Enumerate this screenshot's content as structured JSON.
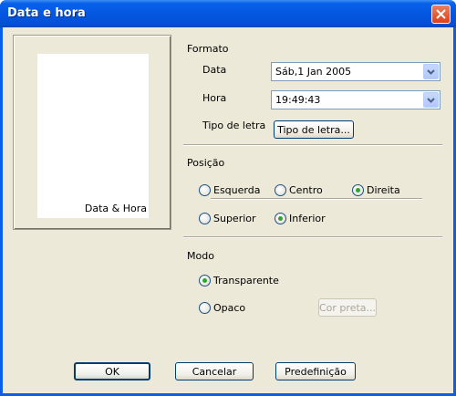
{
  "window": {
    "title": "Data e hora"
  },
  "preview": {
    "label": "Data & Hora"
  },
  "formato": {
    "heading": "Formato",
    "data_label": "Data",
    "data_value": "Sáb,1 Jan 2005",
    "hora_label": "Hora",
    "hora_value": "19:49:43",
    "tipo_label": "Tipo de letra",
    "tipo_button": "Tipo de letra..."
  },
  "posicao": {
    "heading": "Posição",
    "horizontal": [
      {
        "label": "Esquerda",
        "selected": false
      },
      {
        "label": "Centro",
        "selected": false
      },
      {
        "label": "Direita",
        "selected": true
      }
    ],
    "vertical": [
      {
        "label": "Superior",
        "selected": false
      },
      {
        "label": "Inferior",
        "selected": true
      }
    ]
  },
  "modo": {
    "heading": "Modo",
    "options": [
      {
        "label": "Transparente",
        "selected": true
      },
      {
        "label": "Opaco",
        "selected": false
      }
    ],
    "color_button": "Cor preta..."
  },
  "footer": {
    "ok": "OK",
    "cancel": "Cancelar",
    "default": "Predefinição"
  },
  "icons": {
    "close": "close-icon",
    "dropdown": "chevron-down-icon"
  },
  "colors": {
    "titlebar": "#0a5ee8",
    "dialog_bg": "#ece9d8",
    "radio_dot": "#2fa52f"
  }
}
